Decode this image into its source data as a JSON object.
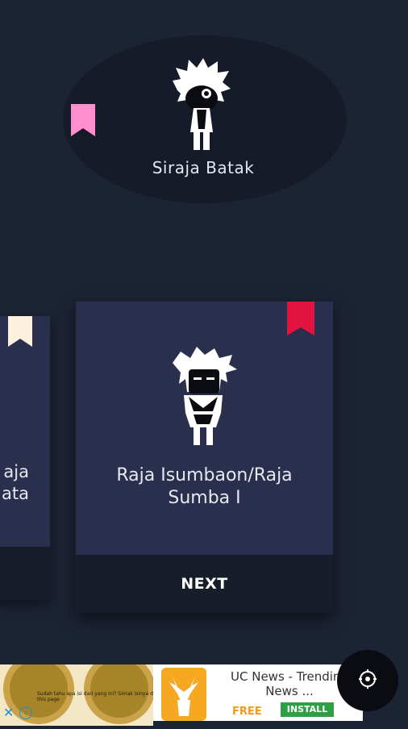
{
  "top_character": {
    "name": "Siraja Batak",
    "ribbon_color": "#ff8fcf"
  },
  "left_card": {
    "title_fragment": "aja\nata",
    "ribbon_color": "#fdf1dd"
  },
  "main_card": {
    "title": "Raja Isumbaon/Raja Sumba I",
    "ribbon_color": "#e3133f",
    "next_label": "NEXT"
  },
  "ad": {
    "title": "UC News - Trending News ...",
    "free_label": "FREE",
    "install_label": "INSTALL",
    "close_label": "✕",
    "info_label": "i",
    "small_text": "Sudah tahu apa isi dari yang ini? Simak isinya di this page"
  },
  "fab": {
    "icon": "compass-icon"
  },
  "colors": {
    "background": "#1c2334",
    "card": "#2a2f4e",
    "card_footer": "#181d2a"
  }
}
